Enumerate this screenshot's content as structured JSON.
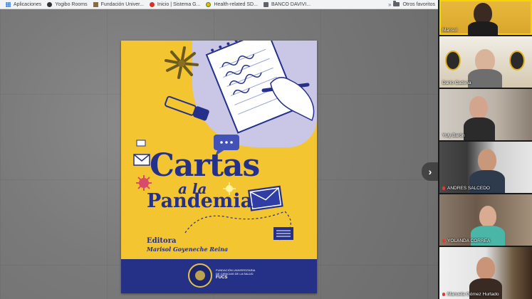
{
  "bookmarks": [
    {
      "label": "Aplicaciones",
      "icon": "apps-icon"
    },
    {
      "label": "Yogibo Rooms",
      "icon": "yogibo-icon"
    },
    {
      "label": "Fundación Univer...",
      "icon": "fuc-icon"
    },
    {
      "label": "Inicio | Sistema G...",
      "icon": "sistema-icon"
    },
    {
      "label": "Health-related SD...",
      "icon": "health-icon"
    },
    {
      "label": "BANCO DAVIVI...",
      "icon": "banco-icon"
    }
  ],
  "bookmarks_overflow": "»",
  "bookmarks_other": "Otros favoritos",
  "cover": {
    "title_line1": "Cartas",
    "title_line2": "a la",
    "title_line3": "Pandemia",
    "editor_label": "Editora",
    "editor_name": "Marisol Goyeneche Reina",
    "footer_line1": "FUNDACIÓN UNIVERSITARIA",
    "footer_line2": "DE CIENCIAS DE LA SALUD",
    "footer_brand": "FUCS"
  },
  "participants": [
    {
      "name": "Marisol",
      "muted": false,
      "active": true
    },
    {
      "name": "Darío Cadena",
      "muted": false,
      "active": false
    },
    {
      "name": "Yuly Barón",
      "muted": false,
      "active": false
    },
    {
      "name": "ANDRES SALCEDO",
      "muted": true,
      "active": false
    },
    {
      "name": "YOLANDA CORREA",
      "muted": true,
      "active": false
    },
    {
      "name": "Manuela Gómez Hurtado",
      "muted": true,
      "active": false
    }
  ],
  "colors": {
    "cover_yellow": "#f3c530",
    "cover_navy": "#25308a",
    "active_outline": "#f5d400"
  }
}
